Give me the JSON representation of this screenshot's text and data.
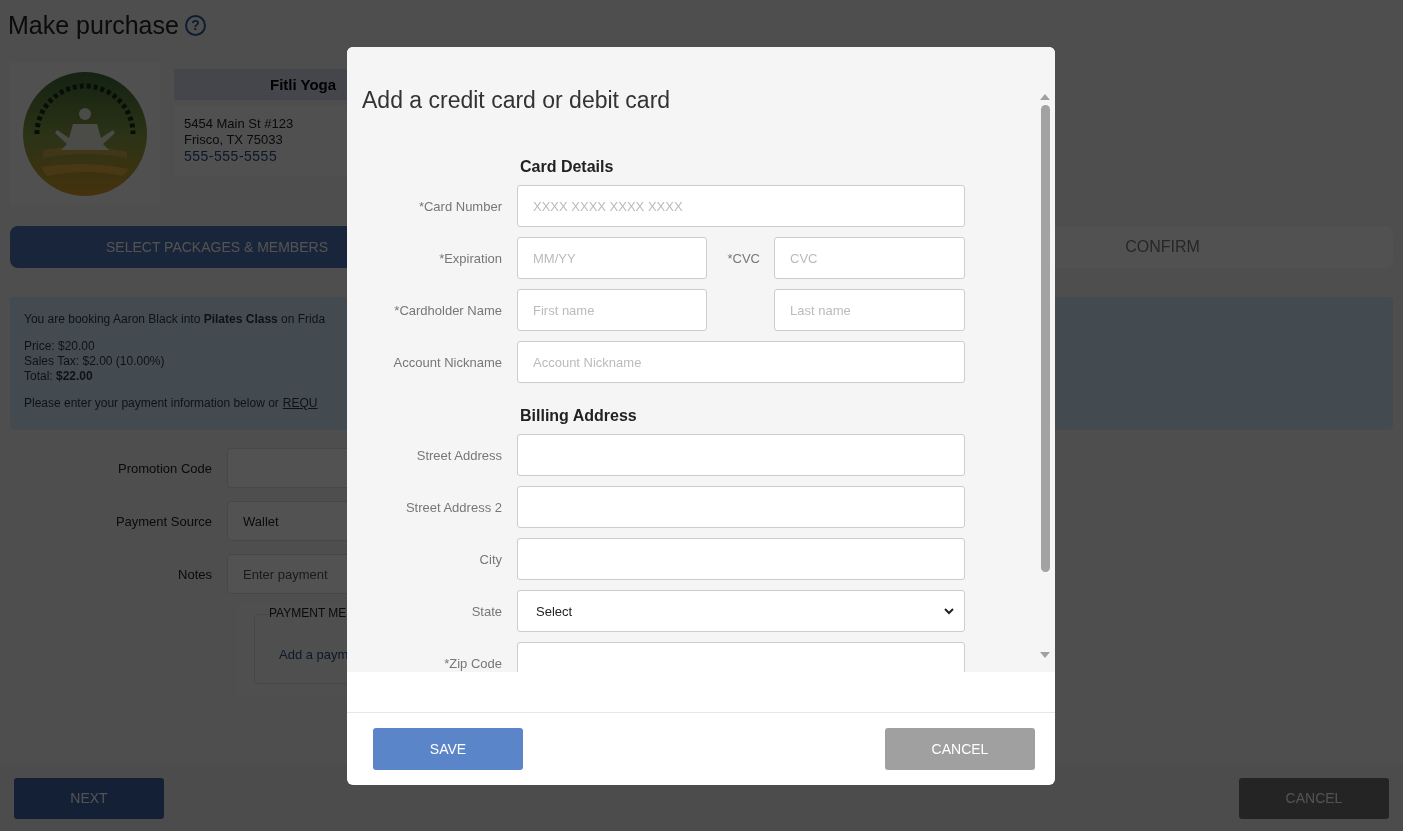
{
  "page": {
    "title": "Make purchase",
    "help": "?",
    "studio": {
      "name": "Fitli Yoga",
      "address": [
        "5454 Main St #123",
        "Frisco, TX 75033"
      ],
      "phone": "555-555-5555"
    },
    "steps": [
      {
        "label": "SELECT PACKAGES & MEMBERS",
        "selected": true
      },
      {
        "label": "CONFIRM",
        "selected": false
      }
    ],
    "booking": {
      "intro": "You are booking Aaron Black into **Pilates Class** on Frida",
      "price": "Price: $20.00",
      "tax": "Sales Tax: $2.00 (10.00%)",
      "total": "Total: **$22.00**",
      "prompt": "Please enter your payment information below or",
      "link": "REQU"
    },
    "fields": [
      {
        "label": "Promotion Code",
        "kind": "input"
      },
      {
        "label": "Payment Source",
        "kind": "select",
        "value": "Wallet"
      },
      {
        "label": "Notes",
        "kind": "input",
        "placeholder": "Enter payment"
      }
    ],
    "payment_methods": {
      "legend": "PAYMENT ME",
      "link": "Add a paym"
    },
    "buttons": {
      "next": "NEXT",
      "cancel": "CANCEL"
    }
  },
  "modal": {
    "title": "Add a credit card or debit card",
    "sections": [
      {
        "heading": "Card Details",
        "rows": [
          {
            "label": "*Card Number",
            "fields": [
              {
                "kind": "input",
                "placeholder": "XXXX XXXX XXXX XXXX"
              }
            ]
          },
          {
            "label": "*Expiration",
            "fields": [
              {
                "kind": "input",
                "placeholder": "MM/YY"
              },
              {
                "kind": "input",
                "label": "*CVC",
                "placeholder": "CVC"
              }
            ]
          },
          {
            "label": "*Cardholder Name",
            "fields": [
              {
                "kind": "input",
                "placeholder": "First name"
              },
              {
                "kind": "input",
                "placeholder": "Last name"
              }
            ]
          },
          {
            "label": "Account Nickname",
            "fields": [
              {
                "kind": "input",
                "placeholder": "Account Nickname"
              }
            ]
          }
        ]
      },
      {
        "heading": "Billing Address",
        "rows": [
          {
            "label": "Street Address",
            "fields": [
              {
                "kind": "input"
              }
            ]
          },
          {
            "label": "Street Address 2",
            "fields": [
              {
                "kind": "input"
              }
            ]
          },
          {
            "label": "City",
            "fields": [
              {
                "kind": "input"
              }
            ]
          },
          {
            "label": "State",
            "fields": [
              {
                "kind": "select",
                "value": "Select"
              }
            ]
          },
          {
            "label": "*Zip Code",
            "fields": [
              {
                "kind": "input"
              }
            ]
          }
        ]
      }
    ],
    "buttons": {
      "save": "SAVE",
      "cancel": "CANCEL"
    }
  }
}
